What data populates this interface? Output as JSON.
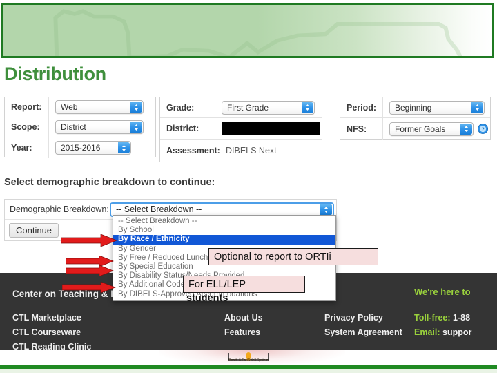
{
  "colors": {
    "banner_border": "#1f7a22",
    "banner_fill": "#b3d6ab",
    "title_green": "#3f8f3c",
    "select_blue": "#2f92e8",
    "highlight_blue": "#1157d6",
    "callout_pink": "#f6dede",
    "arrow_red": "#e21b1b",
    "footer_dark": "#343434",
    "footer_green": "#9ad23c"
  },
  "page": {
    "title": "Distribution"
  },
  "report_panel": {
    "rows": [
      {
        "label": "Report:",
        "value": "Web",
        "control": "select"
      },
      {
        "label": "Scope:",
        "value": "District",
        "control": "select"
      },
      {
        "label": "Year:",
        "value": "2015-2016",
        "control": "select"
      }
    ]
  },
  "grade_panel": {
    "rows": [
      {
        "label": "Grade:",
        "value": "First Grade",
        "control": "select"
      },
      {
        "label": "District:",
        "value": "",
        "control": "redacted"
      },
      {
        "label": "Assessment:",
        "value": "DIBELS Next",
        "control": "text"
      }
    ]
  },
  "period_panel": {
    "rows": [
      {
        "label": "Period:",
        "value": "Beginning",
        "control": "select"
      },
      {
        "label": "NFS:",
        "value": "Former Goals",
        "control": "select",
        "help": "help-icon"
      }
    ]
  },
  "section": {
    "prompt": "Select demographic breakdown to continue:",
    "demographic_label": "Demographic Breakdown:",
    "demographic_value": "-- Select Breakdown --",
    "continue_label": "Continue"
  },
  "dropdown": {
    "open": true,
    "selected_index": 2,
    "options": [
      "-- Select Breakdown --",
      "By School",
      "By Race / Ethnicity",
      "By Gender",
      "By Free / Reduced Lunch",
      "By Special Education",
      "By Disability Status/Needs Provided",
      "By Additional Codes",
      "By DIBELS-Approved Accommodations"
    ]
  },
  "callouts": [
    {
      "text": "Optional to report to ORTIi"
    },
    {
      "text": "For ELL/LEP"
    },
    {
      "text": "students"
    }
  ],
  "arrows": [
    {
      "target": "By Race / Ethnicity"
    },
    {
      "target": "By Free / Reduced Lunch"
    },
    {
      "target": "By Special Education"
    },
    {
      "target": "By Additional Codes"
    }
  ],
  "footer": {
    "brand": "Center on Teaching & Learning",
    "column_1": [
      "CTL Marketplace",
      "CTL Courseware",
      "CTL Reading Clinic"
    ],
    "column_2": [
      "About Us",
      "Features"
    ],
    "column_3": [
      "Privacy Policy",
      "System Agreement"
    ],
    "help_heading": "We're here to",
    "contact": [
      {
        "label": "Toll-free:",
        "value": "1-88"
      },
      {
        "label": "Email:",
        "value": "suppor"
      }
    ]
  },
  "bottom_logo": {
    "caption": "Booth & Freckdell System"
  }
}
